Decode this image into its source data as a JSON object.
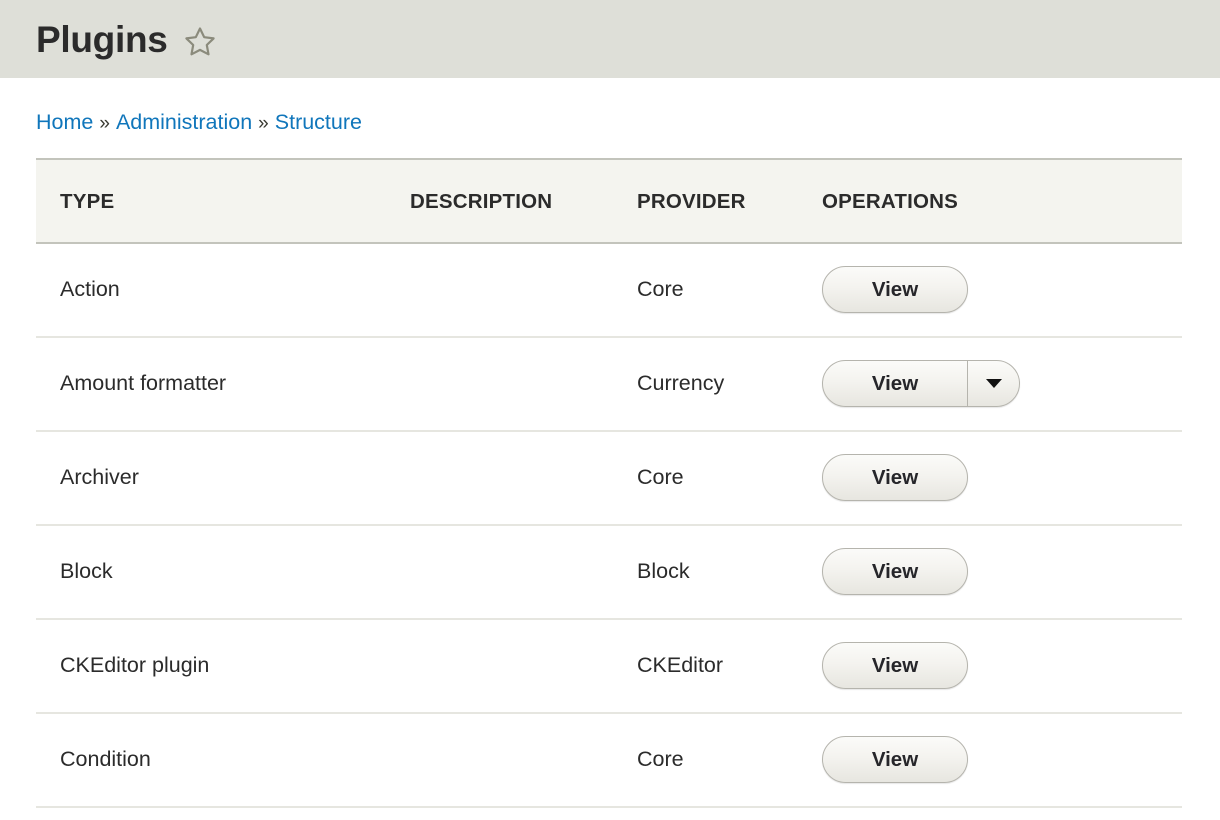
{
  "header": {
    "title": "Plugins",
    "star_icon": "star-outline-icon"
  },
  "breadcrumb": {
    "separator": "»",
    "items": [
      {
        "label": "Home"
      },
      {
        "label": "Administration"
      },
      {
        "label": "Structure"
      }
    ]
  },
  "table": {
    "columns": [
      {
        "key": "type",
        "label": "TYPE"
      },
      {
        "key": "description",
        "label": "DESCRIPTION"
      },
      {
        "key": "provider",
        "label": "PROVIDER"
      },
      {
        "key": "operations",
        "label": "OPERATIONS"
      }
    ],
    "rows": [
      {
        "type": "Action",
        "description": "",
        "provider": "Core",
        "operation_label": "View",
        "has_dropdown": false
      },
      {
        "type": "Amount formatter",
        "description": "",
        "provider": "Currency",
        "operation_label": "View",
        "has_dropdown": true
      },
      {
        "type": "Archiver",
        "description": "",
        "provider": "Core",
        "operation_label": "View",
        "has_dropdown": false
      },
      {
        "type": "Block",
        "description": "",
        "provider": "Block",
        "operation_label": "View",
        "has_dropdown": false
      },
      {
        "type": "CKEditor plugin",
        "description": "",
        "provider": "CKEditor",
        "operation_label": "View",
        "has_dropdown": false
      },
      {
        "type": "Condition",
        "description": "",
        "provider": "Core",
        "operation_label": "View",
        "has_dropdown": false
      }
    ]
  },
  "colors": {
    "header_band": "#dedfd8",
    "link": "#1076bb",
    "text": "#2b2b2b",
    "table_head_bg": "#f4f4ef",
    "table_head_border": "#c3c4bc",
    "row_divider": "#e6e6e0",
    "star_stroke": "#8b8b7c",
    "button_border": "#b5b4ad"
  }
}
